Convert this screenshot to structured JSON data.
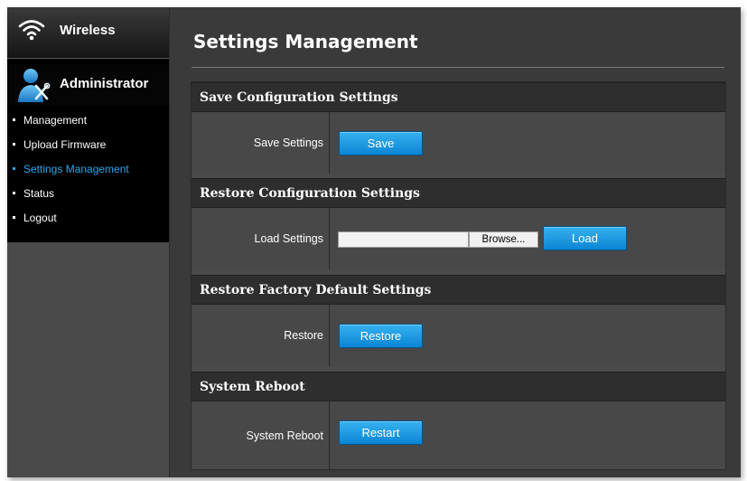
{
  "sidebar": {
    "wireless_label": "Wireless",
    "admin_label": "Administrator",
    "items": [
      {
        "label": "Management",
        "active": false
      },
      {
        "label": "Upload Firmware",
        "active": false
      },
      {
        "label": "Settings Management",
        "active": true
      },
      {
        "label": "Status",
        "active": false
      },
      {
        "label": "Logout",
        "active": false
      }
    ]
  },
  "main": {
    "title": "Settings Management",
    "sections": {
      "save": {
        "header": "Save Configuration Settings",
        "label": "Save Settings",
        "button": "Save"
      },
      "restore_config": {
        "header": "Restore Configuration Settings",
        "label": "Load Settings",
        "browse": "Browse...",
        "file_value": "",
        "button": "Load"
      },
      "factory": {
        "header": "Restore Factory Default Settings",
        "label": "Restore",
        "button": "Restore"
      },
      "reboot": {
        "header": "System Reboot",
        "label": "System Reboot",
        "button": "Restart"
      }
    }
  },
  "colors": {
    "accent": "#2ea6e8",
    "button": "#1a9be6",
    "background": "#3a3a3a",
    "section_header": "#2e2e2e"
  },
  "icons": {
    "wireless": "wifi-icon",
    "administrator": "admin-tools-icon"
  }
}
